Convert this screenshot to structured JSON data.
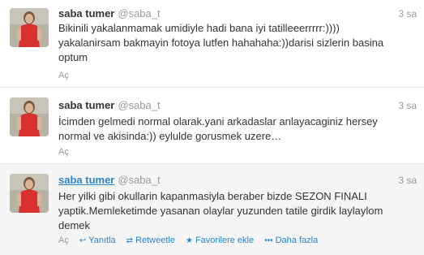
{
  "tweets": [
    {
      "name": "saba tumer",
      "handle": "@saba_t",
      "time": "3 sa",
      "text": "Bikinili yakalanmamak umidiyle hadi bana iyi tatilleeerrrrr:)))) yakalanirsam bakmayin fotoya lutfen hahahaha:))darisi sizlerin basina optum",
      "expand": "Aç"
    },
    {
      "name": "saba tumer",
      "handle": "@saba_t",
      "time": "3 sa",
      "text": "İcimden gelmedi normal olarak.yani arkadaslar anlayacaginiz hersey normal ve akisinda:)) eylulde gorusmek uzere…",
      "expand": "Aç"
    },
    {
      "name": "saba tumer",
      "handle": "@saba_t",
      "time": "3 sa",
      "text": "Her yilki gibi okullarin kapanmasiyla beraber bizde SEZON FINALI yaptik.Memleketimde yasanan olaylar yuzunden tatile girdik laylaylom demek",
      "expand": "Aç",
      "actions": {
        "reply": "Yanıtla",
        "retweet": "Retweetle",
        "favorite": "Favorilere ekle",
        "more": "Daha fazla"
      }
    }
  ],
  "icons": {
    "reply": "reply-arrow-icon",
    "retweet": "retweet-icon",
    "favorite": "star-icon",
    "more": "ellipsis-icon"
  },
  "colors": {
    "link": "#2a85c6",
    "muted": "#999999",
    "text": "#333333",
    "hover_bg": "#f5f5f5",
    "divider": "#e8e8e8"
  }
}
